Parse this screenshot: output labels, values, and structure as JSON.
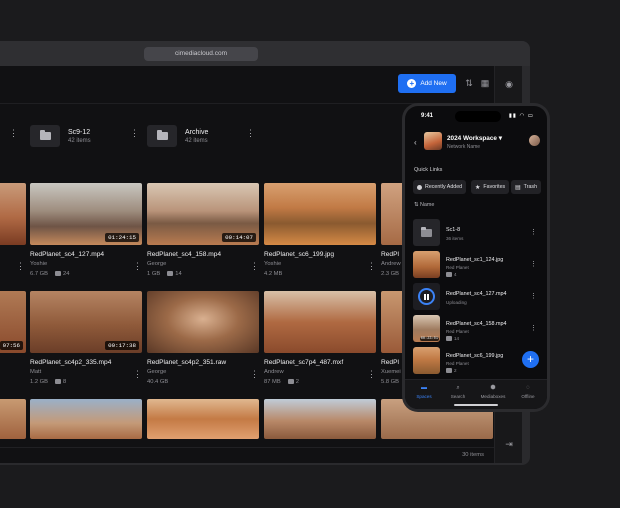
{
  "browser": {
    "url": "cimediacloud.com"
  },
  "toolbar": {
    "add_label": "Add New"
  },
  "folders": [
    {
      "name": "Sc9-12",
      "meta": "42 items"
    },
    {
      "name": "Archive",
      "meta": "42 items"
    }
  ],
  "row1": [
    {
      "title": "RedPlanet_sc4_127.mp4",
      "user": "Yoshie",
      "size": "6.7 GB",
      "comments": "24",
      "duration": "01:24:15"
    },
    {
      "title": "RedPlanet_sc4_158.mp4",
      "user": "George",
      "size": "1 GB",
      "comments": "14",
      "duration": "00:14:07"
    },
    {
      "title": "RedPlanet_sc6_199.jpg",
      "user": "Yoshie",
      "size": "4.2 MB",
      "comments": "",
      "duration": ""
    },
    {
      "title": "RedPl",
      "user": "Andrew",
      "size": "2.3 GB",
      "comments": "",
      "duration": ""
    }
  ],
  "row2": [
    {
      "title": "RedPlanet_sc4p2_335.mp4",
      "user": "Matt",
      "size": "1.2 GB",
      "comments": "8",
      "duration": "00:17:38"
    },
    {
      "title": "RedPlanet_sc4p2_351.raw",
      "user": "George",
      "size": "40.4 GB",
      "comments": "",
      "duration": ""
    },
    {
      "title": "RedPlanet_sc7p4_487.mxf",
      "user": "Andrew",
      "size": "87 MB",
      "comments": "2",
      "duration": ""
    },
    {
      "title": "RedPl",
      "user": "Xuemei",
      "size": "5.8 GB",
      "comments": "",
      "duration": ""
    }
  ],
  "partial_left_duration": "07:56",
  "status": {
    "count": "30 items"
  },
  "phone": {
    "time": "9:41",
    "workspace": "2024 Workspace",
    "workspace_sub": "Network Name",
    "quick_links_label": "Quick Links",
    "chips": [
      "Recently Added",
      "Favorites",
      "Trash"
    ],
    "sort_label": "Name",
    "items": [
      {
        "name": "Sc1-8",
        "sub": "36 items",
        "count": ""
      },
      {
        "name": "RedPlanet_sc1_124.jpg",
        "sub": "Red Planet",
        "count": "4"
      },
      {
        "name": "RedPlanet_sc4_127.mp4",
        "sub": "Uploading",
        "count": ""
      },
      {
        "name": "RedPlanet_sc4_158.mp4",
        "sub": "Red Planet",
        "count": "14",
        "duration": "00:23:01"
      },
      {
        "name": "RedPlanet_sc6_199.jpg",
        "sub": "Red Planet",
        "count": "2"
      }
    ],
    "nav": [
      "Spaces",
      "Search",
      "Mediaboxes",
      "Offline"
    ]
  },
  "colors": {
    "accent": "#1f6ff2",
    "background": "#111113"
  }
}
